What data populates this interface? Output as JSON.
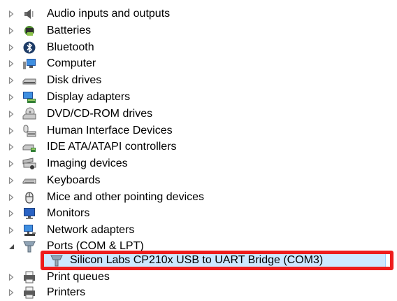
{
  "tree": {
    "items": [
      {
        "label": "Audio inputs and outputs",
        "icon": "speaker-icon",
        "expanded": false
      },
      {
        "label": "Batteries",
        "icon": "battery-icon",
        "expanded": false
      },
      {
        "label": "Bluetooth",
        "icon": "bluetooth-icon",
        "expanded": false
      },
      {
        "label": "Computer",
        "icon": "computer-icon",
        "expanded": false
      },
      {
        "label": "Disk drives",
        "icon": "disk-drive-icon",
        "expanded": false
      },
      {
        "label": "Display adapters",
        "icon": "display-adapter-icon",
        "expanded": false
      },
      {
        "label": "DVD/CD-ROM drives",
        "icon": "dvd-drive-icon",
        "expanded": false
      },
      {
        "label": "Human Interface Devices",
        "icon": "hid-icon",
        "expanded": false
      },
      {
        "label": "IDE ATA/ATAPI controllers",
        "icon": "ide-controller-icon",
        "expanded": false
      },
      {
        "label": "Imaging devices",
        "icon": "scanner-icon",
        "expanded": false
      },
      {
        "label": "Keyboards",
        "icon": "keyboard-icon",
        "expanded": false
      },
      {
        "label": "Mice and other pointing devices",
        "icon": "mouse-icon",
        "expanded": false
      },
      {
        "label": "Monitors",
        "icon": "monitor-icon",
        "expanded": false
      },
      {
        "label": "Network adapters",
        "icon": "network-adapter-icon",
        "expanded": false
      },
      {
        "label": "Ports (COM & LPT)",
        "icon": "port-icon",
        "expanded": true
      },
      {
        "label": "Print queues",
        "icon": "printer-icon",
        "expanded": false
      },
      {
        "label": "Printers",
        "icon": "printer-icon",
        "expanded": false
      }
    ],
    "selected_child": {
      "label": "Silicon Labs CP210x USB to UART Bridge (COM3)",
      "icon": "port-icon",
      "parent": "Ports (COM & LPT)"
    }
  },
  "colors": {
    "highlight_border": "#ee1c1c",
    "selection_background": "#cde8ff",
    "selection_border": "#99d1ff"
  }
}
